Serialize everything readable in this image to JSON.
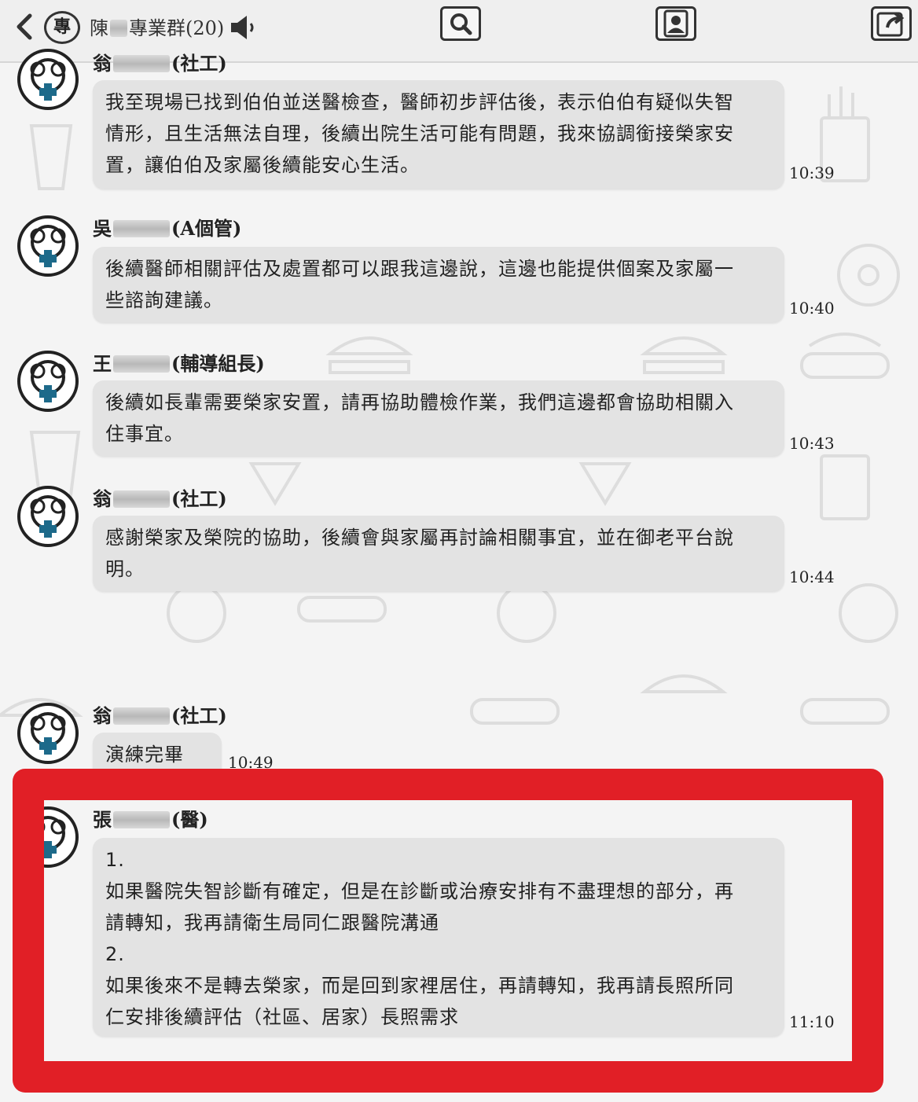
{
  "header": {
    "group_badge": "專",
    "group_name_prefix": "陳",
    "group_name_suffix": "專業群(20)"
  },
  "messages": [
    {
      "sender_prefix": "翁",
      "sender_role": "(社工)",
      "lines": [
        "我至現場已找到伯伯並送醫檢查，醫師初步評估後，表示伯伯有疑似失智",
        "情形，且生活無法自理，後續出院生活可能有問題，我來協調銜接榮家安",
        "置，讓伯伯及家屬後續能安心生活。"
      ],
      "time": "10:39"
    },
    {
      "sender_prefix": "吳",
      "sender_role": "(A個管)",
      "lines": [
        "後續醫師相關評估及處置都可以跟我這邊說，這邊也能提供個案及家屬一",
        "些諮詢建議。"
      ],
      "time": "10:40"
    },
    {
      "sender_prefix": "王",
      "sender_role": "(輔導組長)",
      "lines": [
        "後續如長輩需要榮家安置，請再協助體檢作業，我們這邊都會協助相關入",
        "住事宜。"
      ],
      "time": "10:43"
    },
    {
      "sender_prefix": "翁",
      "sender_role": "(社工)",
      "lines": [
        "感謝榮家及榮院的協助，後續會與家屬再討論相關事宜，並在御老平台說",
        "明。"
      ],
      "time": "10:44"
    },
    {
      "sender_prefix": "翁",
      "sender_role": "(社工)",
      "lines": [
        "演練完畢"
      ],
      "time": "10:49"
    },
    {
      "sender_prefix": "張",
      "sender_role": "(醫)",
      "lines": [
        "1.",
        "如果醫院失智診斷有確定，但是在診斷或治療安排有不盡理想的部分，再",
        "請轉知，我再請衛生局同仁跟醫院溝通",
        "2.",
        "如果後來不是轉去榮家，而是回到家裡居住，再請轉知，我再請長照所同",
        "仁安排後續評估（社區、居家）長照需求"
      ],
      "time": "11:10"
    }
  ],
  "colors": {
    "highlight": "#e11f26",
    "bubble": "#e3e3e3",
    "background": "#f4f4f4"
  },
  "icons": {
    "back": "chevron-left-icon",
    "speaker": "speaker-icon",
    "search": "search-icon",
    "contact": "contact-icon",
    "share": "share-icon",
    "avatar": "avatar-logo-icon"
  }
}
